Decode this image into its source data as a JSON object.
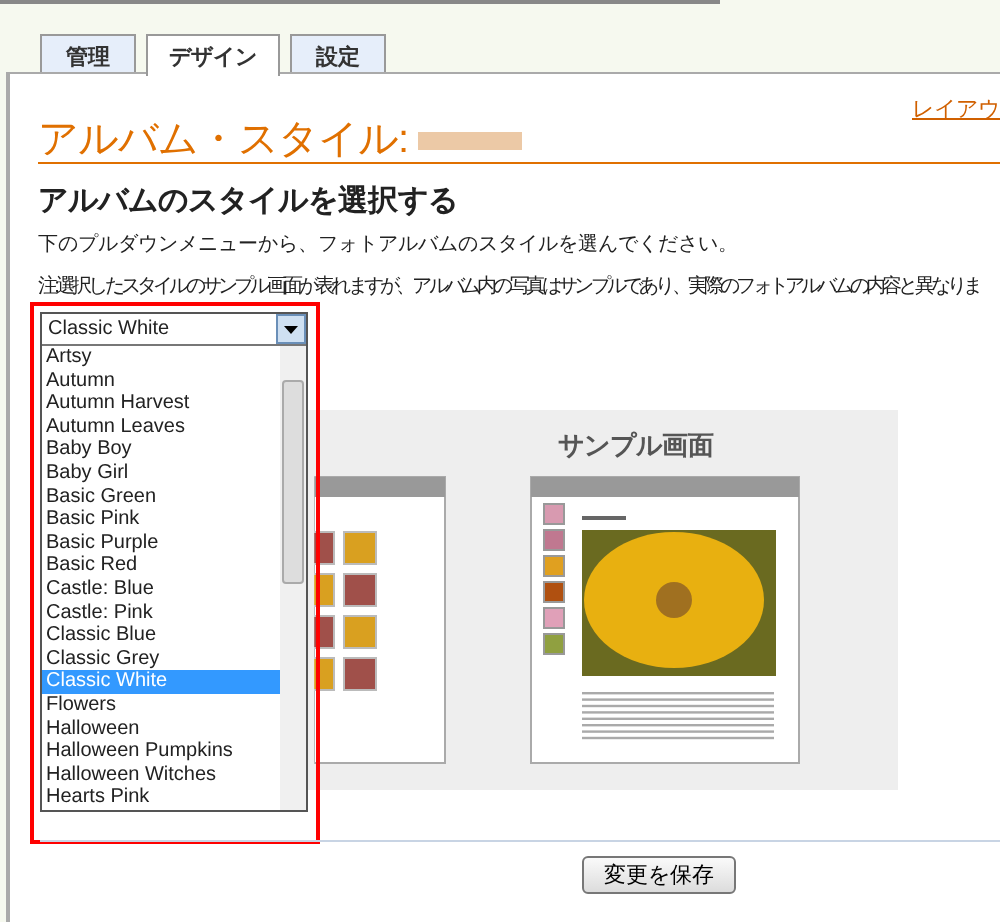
{
  "tabs": [
    {
      "label": "管理",
      "selected": false
    },
    {
      "label": "デザイン",
      "selected": true
    },
    {
      "label": "設定",
      "selected": false
    }
  ],
  "layout_link": "レイアウ",
  "page_title": "アルバム・スタイル:",
  "heading": "アルバムのスタイルを選択する",
  "description": "下のプルダウンメニューから、フォトアルバムのスタイルを選んでください。",
  "note": "注:選択したスタイルのサンプル画面が表れますが、アルバム内の写真はサンプルであり、実際のフォトアルバムの内容と異なりま",
  "style_dropdown": {
    "value": "Classic White",
    "expanded": true,
    "options": [
      {
        "label": "Artsy",
        "selected": false
      },
      {
        "label": "Autumn",
        "selected": false
      },
      {
        "label": "Autumn Harvest",
        "selected": false
      },
      {
        "label": "Autumn Leaves",
        "selected": false
      },
      {
        "label": "Baby Boy",
        "selected": false
      },
      {
        "label": "Baby Girl",
        "selected": false
      },
      {
        "label": "Basic Green",
        "selected": false
      },
      {
        "label": "Basic Pink",
        "selected": false
      },
      {
        "label": "Basic Purple",
        "selected": false
      },
      {
        "label": "Basic Red",
        "selected": false
      },
      {
        "label": "Castle: Blue",
        "selected": false
      },
      {
        "label": "Castle: Pink",
        "selected": false
      },
      {
        "label": "Classic Blue",
        "selected": false
      },
      {
        "label": "Classic Grey",
        "selected": false
      },
      {
        "label": "Classic White",
        "selected": true
      },
      {
        "label": "Flowers",
        "selected": false
      },
      {
        "label": "Halloween",
        "selected": false
      },
      {
        "label": "Halloween Pumpkins",
        "selected": false
      },
      {
        "label": "Halloween Witches",
        "selected": false
      },
      {
        "label": "Hearts Pink",
        "selected": false
      }
    ]
  },
  "sample": {
    "title": "サンプル画面"
  },
  "save_button": "変更を保存"
}
